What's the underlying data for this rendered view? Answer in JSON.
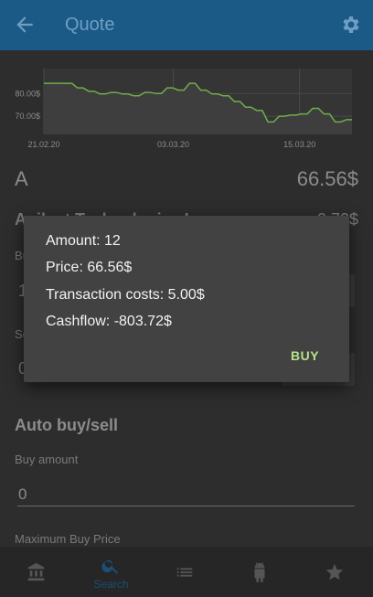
{
  "appbar": {
    "title": "Quote",
    "back_icon": "arrow-back-icon",
    "settings_icon": "gear-icon"
  },
  "chart_data": {
    "type": "line",
    "x_tick_labels": [
      "21.02.20",
      "03.03.20",
      "15.03.20"
    ],
    "y_tick_labels": [
      "80.00$",
      "70.00$"
    ],
    "x": [
      0,
      1,
      2,
      3,
      4,
      5,
      6,
      7,
      8,
      9,
      10,
      11,
      12,
      13,
      14,
      15,
      16,
      17,
      18,
      19,
      20,
      21,
      22,
      23,
      24,
      25,
      26,
      27,
      28,
      29,
      30,
      31,
      32,
      33,
      34,
      35,
      36,
      37,
      38,
      39,
      40,
      41,
      42,
      43,
      44,
      45,
      46,
      47,
      48,
      49,
      50,
      51,
      52,
      53,
      54,
      55
    ],
    "y": [
      84.5,
      84.5,
      84.5,
      84.5,
      84.5,
      84.5,
      82.5,
      82.5,
      81.0,
      81.0,
      79.8,
      79.8,
      80.5,
      80.5,
      79.8,
      79.8,
      79.0,
      79.0,
      80.5,
      80.5,
      80.0,
      80.0,
      82.5,
      82.5,
      81.5,
      81.5,
      84.5,
      84.5,
      81.5,
      81.5,
      79.8,
      79.8,
      79.0,
      79.0,
      76.5,
      76.5,
      74.0,
      74.0,
      72.5,
      72.5,
      67.5,
      67.5,
      70.0,
      70.0,
      70.5,
      70.5,
      71.0,
      71.0,
      73.5,
      73.5,
      71.0,
      71.0,
      67.5,
      67.5,
      68.5,
      68.5
    ],
    "ylim": [
      62,
      91
    ],
    "line_color": "#6fae4b"
  },
  "quote": {
    "symbol": "A",
    "price": "66.56$",
    "company": "Agilent Technologies Inc",
    "change": "-0.70$"
  },
  "dimmed": {
    "buy_label": "Buy",
    "buy_value": "1",
    "sell_label": "Sell",
    "sell_value": "0"
  },
  "auto": {
    "section_title": "Auto buy/sell",
    "buy_amount_label": "Buy amount",
    "buy_amount_value": "0",
    "max_buy_label": "Maximum Buy Price"
  },
  "bottom_nav": [
    {
      "icon": "bank-icon",
      "label": ""
    },
    {
      "icon": "search-icon",
      "label": "Search",
      "active": true
    },
    {
      "icon": "list-icon",
      "label": ""
    },
    {
      "icon": "android-icon",
      "label": ""
    },
    {
      "icon": "star-icon",
      "label": ""
    }
  ],
  "dialog": {
    "amount": "Amount: 12",
    "price": "Price: 66.56$",
    "costs": "Transaction costs: 5.00$",
    "cashflow": "Cashflow: -803.72$",
    "action": "BUY",
    "action_color": "#b6e28a"
  },
  "colors": {
    "appbar": "#1b5a86",
    "background": "#2d2d2d",
    "dialog": "#424242",
    "accent": "#1b4f74"
  }
}
